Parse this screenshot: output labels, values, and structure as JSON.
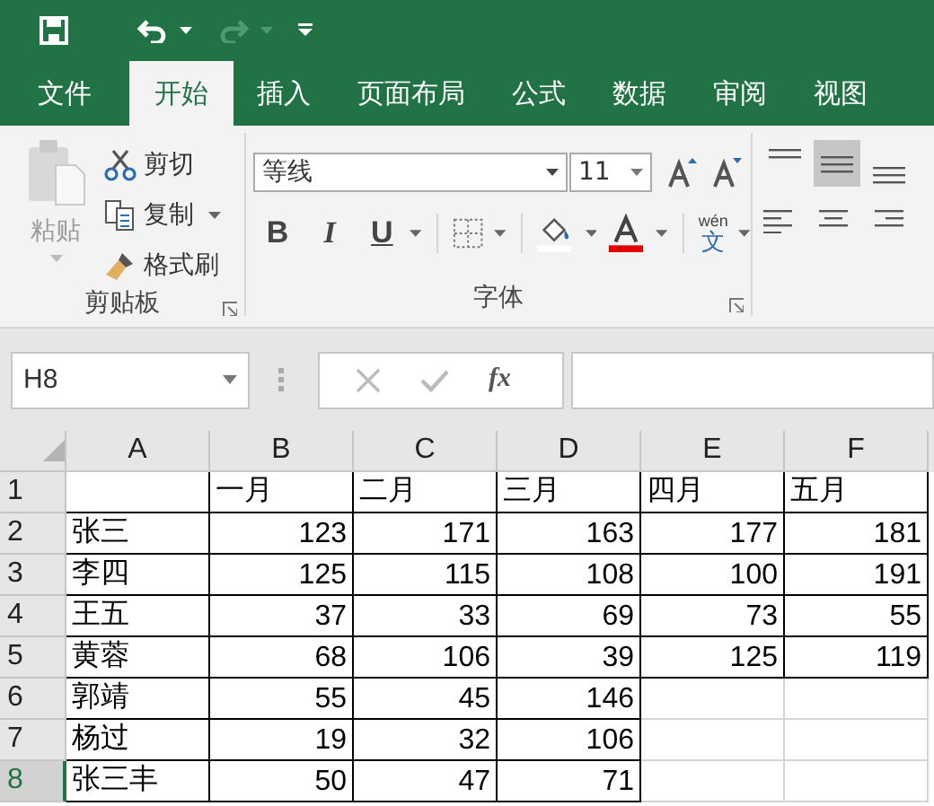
{
  "quick_access": [
    {
      "kind": "save",
      "disabled": false
    },
    {
      "kind": "undo",
      "disabled": false
    },
    {
      "kind": "redo",
      "disabled": true
    },
    {
      "kind": "customize",
      "disabled": false
    }
  ],
  "tabs": [
    {
      "label": "文件",
      "selected": false
    },
    {
      "label": "开始",
      "selected": true
    },
    {
      "label": "插入",
      "selected": false
    },
    {
      "label": "页面布局",
      "selected": false
    },
    {
      "label": "公式",
      "selected": false
    },
    {
      "label": "数据",
      "selected": false
    },
    {
      "label": "审阅",
      "selected": false
    },
    {
      "label": "视图",
      "selected": false
    }
  ],
  "clipboard": {
    "label": "剪贴板",
    "paste": {
      "label": "粘贴",
      "disabled": true
    },
    "cut": "剪切",
    "copy": "复制",
    "format_painter": "格式刷"
  },
  "font": {
    "label": "字体",
    "font_name": "等线",
    "font_size": "11",
    "bold": "B",
    "italic": "I",
    "underline": "U",
    "phonetic_top": "wén",
    "phonetic_bottom": "文"
  },
  "alignment": {
    "middle_selected": true
  },
  "formula_bar": {
    "name_box": "H8",
    "fx": "fx"
  },
  "sheet": {
    "columns": [
      "A",
      "B",
      "C",
      "D",
      "E",
      "F"
    ],
    "rows": [
      {
        "header": "1",
        "selected": false,
        "cells": [
          "",
          "一月",
          "二月",
          "三月",
          "四月",
          "五月"
        ]
      },
      {
        "header": "2",
        "selected": false,
        "cells": [
          "张三",
          "123",
          "171",
          "163",
          "177",
          "181"
        ]
      },
      {
        "header": "3",
        "selected": false,
        "cells": [
          "李四",
          "125",
          "115",
          "108",
          "100",
          "191"
        ]
      },
      {
        "header": "4",
        "selected": false,
        "cells": [
          "王五",
          "37",
          "33",
          "69",
          "73",
          "55"
        ]
      },
      {
        "header": "5",
        "selected": false,
        "cells": [
          "黄蓉",
          "68",
          "106",
          "39",
          "125",
          "119"
        ]
      },
      {
        "header": "6",
        "selected": false,
        "cells": [
          "郭靖",
          "55",
          "45",
          "146"
        ]
      },
      {
        "header": "7",
        "selected": false,
        "cells": [
          "杨过",
          "19",
          "32",
          "106"
        ]
      },
      {
        "header": "8",
        "selected": true,
        "cells": [
          "张三丰",
          "50",
          "47",
          "71"
        ]
      }
    ]
  }
}
